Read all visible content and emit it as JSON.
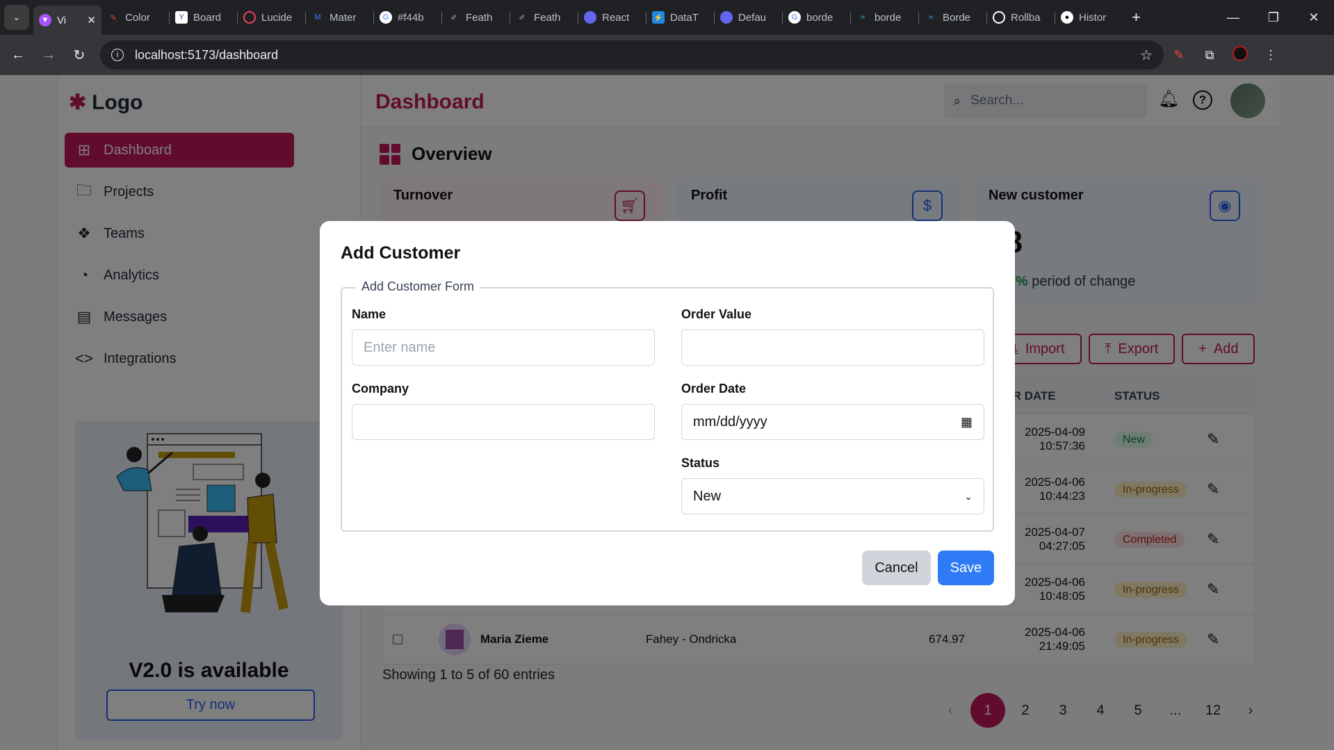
{
  "browser": {
    "tabs": [
      {
        "label": "Vi",
        "icon": "vite-icon",
        "color": "#a855f7"
      },
      {
        "label": "Color",
        "icon": "brush-icon",
        "color": "#ef4444"
      },
      {
        "label": "Board",
        "icon": "yahoo-icon",
        "color": "#ffffff"
      },
      {
        "label": "Lucide",
        "icon": "lucide-icon",
        "color": "#f43f5e"
      },
      {
        "label": "Mater",
        "icon": "mui-icon",
        "color": "#3b82f6"
      },
      {
        "label": "#f44b",
        "icon": "google-icon",
        "color": "#ffffff"
      },
      {
        "label": "Feath",
        "icon": "feather-icon",
        "color": "#9ca3af"
      },
      {
        "label": "Feath",
        "icon": "feather-icon",
        "color": "#9ca3af"
      },
      {
        "label": "React",
        "icon": "react-icon",
        "color": "#6366f1"
      },
      {
        "label": "DataT",
        "icon": "datatables-icon",
        "color": "#1e88e5"
      },
      {
        "label": "Defau",
        "icon": "react-icon",
        "color": "#6366f1"
      },
      {
        "label": "borde",
        "icon": "google-icon",
        "color": "#ffffff"
      },
      {
        "label": "borde",
        "icon": "tailwind-icon",
        "color": "#38bdf8"
      },
      {
        "label": "Borde",
        "icon": "tailwind-icon",
        "color": "#38bdf8"
      },
      {
        "label": "Rollba",
        "icon": "rollbar-icon",
        "color": "#ffffff"
      },
      {
        "label": "Histor",
        "icon": "github-icon",
        "color": "#ffffff"
      }
    ],
    "url": "localhost:5173/dashboard"
  },
  "sidebar": {
    "logo": "Logo",
    "items": [
      {
        "label": "Dashboard",
        "icon": "grid-icon"
      },
      {
        "label": "Projects",
        "icon": "folder-icon"
      },
      {
        "label": "Teams",
        "icon": "boxes-icon"
      },
      {
        "label": "Analytics",
        "icon": "pie-chart-icon"
      },
      {
        "label": "Messages",
        "icon": "message-icon"
      },
      {
        "label": "Integrations",
        "icon": "code-icon"
      }
    ],
    "promo": {
      "title": "V2.0 is available",
      "button": "Try now"
    }
  },
  "header": {
    "title": "Dashboard",
    "search_placeholder": "Search..."
  },
  "overview": {
    "title": "Overview",
    "cards": [
      {
        "title": "Turnover",
        "icon": "cart-icon",
        "bg": "#fdf0f4",
        "accent": "#c2185b"
      },
      {
        "title": "Profit",
        "icon": "dollar-icon",
        "bg": "#eef4fe",
        "accent": "#2563eb"
      },
      {
        "title": "New customer",
        "icon": "user-circle-icon",
        "bg": "#eef4fe",
        "accent": "#2563eb",
        "value": "98",
        "change": "2.79%",
        "change_label": "period of change"
      }
    ]
  },
  "toolbar": {
    "import": "Import",
    "export": "Export",
    "add": "Add"
  },
  "table": {
    "headers": {
      "order_date": "DER DATE",
      "status": "STATUS"
    },
    "rows": [
      {
        "date": "2025-04-09",
        "time": "10:57:36",
        "status": "New"
      },
      {
        "date": "2025-04-06",
        "time": "10:44:23",
        "status": "In-progress"
      },
      {
        "date": "2025-04-07",
        "time": "04:27:05",
        "status": "Completed"
      },
      {
        "date": "2025-04-06",
        "time": "10:48:05",
        "status": "In-progress"
      },
      {
        "name": "Maria Zieme",
        "company": "Fahey - Ondricka",
        "value": "674.97",
        "date": "2025-04-06",
        "time": "21:49:05",
        "status": "In-progress"
      }
    ],
    "showing": "Showing 1 to 5 of 60 entries",
    "pages": [
      "1",
      "2",
      "3",
      "4",
      "5",
      "...",
      "12"
    ]
  },
  "modal": {
    "title": "Add Customer",
    "legend": "Add Customer Form",
    "name_label": "Name",
    "name_placeholder": "Enter name",
    "order_value_label": "Order Value",
    "company_label": "Company",
    "order_date_label": "Order Date",
    "order_date_value": "mm/dd/yyyy",
    "status_label": "Status",
    "status_value": "New",
    "cancel": "Cancel",
    "save": "Save"
  }
}
